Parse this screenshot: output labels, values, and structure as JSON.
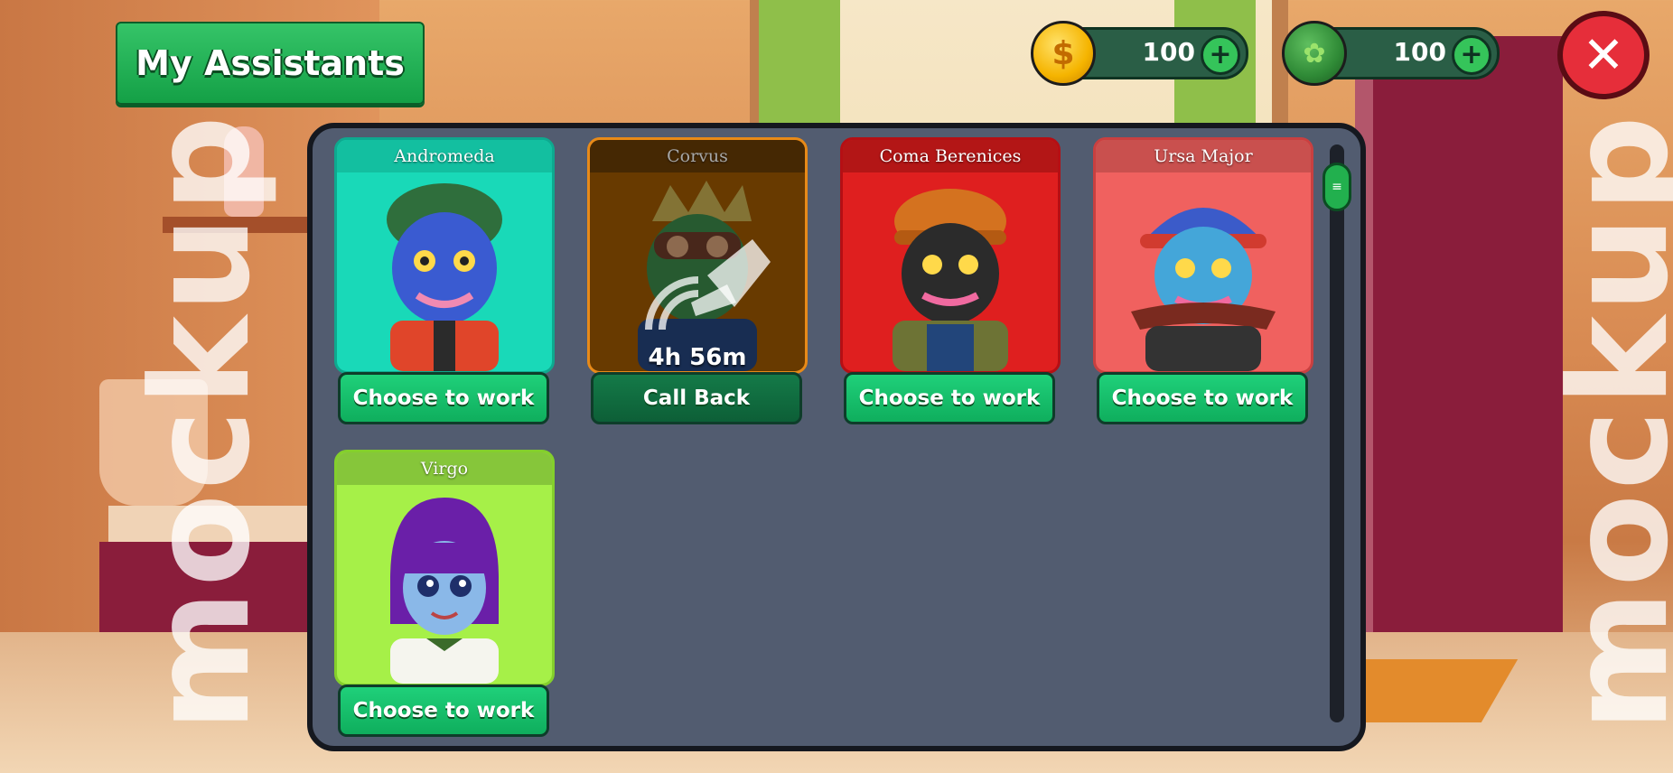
{
  "header": {
    "title": "My Assistants"
  },
  "currencies": [
    {
      "name": "coins",
      "icon": "dollar-coin-icon",
      "symbol": "$",
      "amount": "100"
    },
    {
      "name": "weed",
      "icon": "leaf-coin-icon",
      "symbol": "✿",
      "amount": "100"
    }
  ],
  "close_symbol": "✕",
  "watermark": "mockup",
  "assistants": [
    {
      "name": "Andromeda",
      "status": "available",
      "button": "Choose to work",
      "color": "#19d9b8"
    },
    {
      "name": "Corvus",
      "status": "working",
      "timer": "4h 56m",
      "button": "Call Back",
      "color": "#a05a00"
    },
    {
      "name": "Coma Berenices",
      "status": "available",
      "button": "Choose to work",
      "color": "#df1f1f"
    },
    {
      "name": "Ursa Major",
      "status": "available",
      "button": "Choose to work",
      "color": "#f0615f"
    },
    {
      "name": "Virgo",
      "status": "available",
      "button": "Choose to work",
      "color": "#a6f048"
    }
  ]
}
